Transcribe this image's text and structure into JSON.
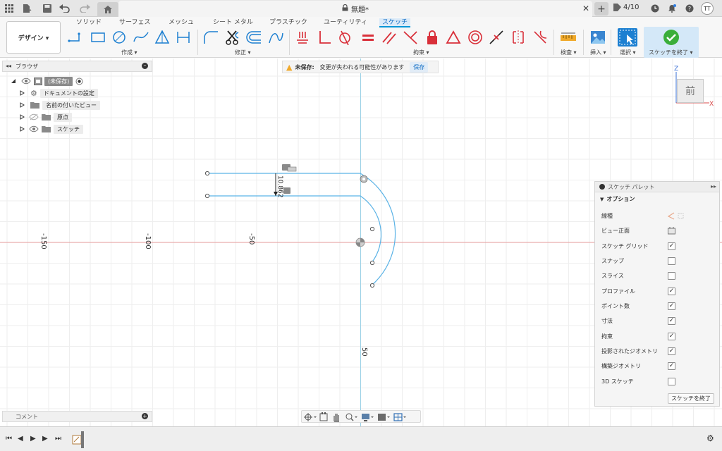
{
  "titlebar": {
    "doc_title": "無題*",
    "job_count": "4/10",
    "avatar_initials": "TT"
  },
  "ribbon": {
    "workspace": "デザイン ▾",
    "tabs": [
      "ソリッド",
      "サーフェス",
      "メッシュ",
      "シート メタル",
      "プラスチック",
      "ユーティリティ",
      "スケッチ"
    ],
    "active_tab": "スケッチ",
    "groups": {
      "create": "作成 ▾",
      "modify": "修正 ▾",
      "constraints": "拘束 ▾",
      "inspect": "検査 ▾",
      "insert": "挿入 ▾",
      "select": "選択 ▾",
      "finish": "スケッチを終了 ▾"
    }
  },
  "browser": {
    "title": "ブラウザ",
    "items": [
      {
        "label": "(未保存)",
        "icon": "component-icon"
      },
      {
        "label": "ドキュメントの設定",
        "icon": "gear-icon"
      },
      {
        "label": "名前の付いたビュー",
        "icon": "folder-icon"
      },
      {
        "label": "原点",
        "icon": "folder-icon"
      },
      {
        "label": "スケッチ",
        "icon": "folder-icon"
      }
    ]
  },
  "save_banner": {
    "label": "未保存:",
    "message": "変更が失われる可能性があります",
    "button": "保存"
  },
  "viewcube": {
    "face": "前",
    "axis_z": "Z",
    "axis_x": "X"
  },
  "canvas": {
    "ruler_labels": [
      "-150",
      "-100",
      "-50",
      "50"
    ],
    "dimension": "10.862"
  },
  "sketch_palette": {
    "title": "スケッチ パレット",
    "section": "オプション",
    "options": [
      {
        "label": "線種",
        "type": "icons"
      },
      {
        "label": "ビュー正面",
        "type": "button"
      },
      {
        "label": "スケッチ グリッド",
        "type": "checkbox",
        "checked": true
      },
      {
        "label": "スナップ",
        "type": "checkbox",
        "checked": false
      },
      {
        "label": "スライス",
        "type": "checkbox",
        "checked": false
      },
      {
        "label": "プロファイル",
        "type": "checkbox",
        "checked": true
      },
      {
        "label": "ポイント数",
        "type": "checkbox",
        "checked": true
      },
      {
        "label": "寸法",
        "type": "checkbox",
        "checked": true
      },
      {
        "label": "拘束",
        "type": "checkbox",
        "checked": true
      },
      {
        "label": "投影されたジオメトリ",
        "type": "checkbox",
        "checked": true
      },
      {
        "label": "構築ジオメトリ",
        "type": "checkbox",
        "checked": true
      },
      {
        "label": "3D スケッチ",
        "type": "checkbox",
        "checked": false
      }
    ],
    "finish_button": "スケッチを終了"
  },
  "comments": {
    "title": "コメント"
  },
  "colors": {
    "accent": "#0696d7",
    "sketch_line": "#5bb3e6",
    "constraint_red": "#d9303a",
    "warning": "#f0a92b"
  }
}
